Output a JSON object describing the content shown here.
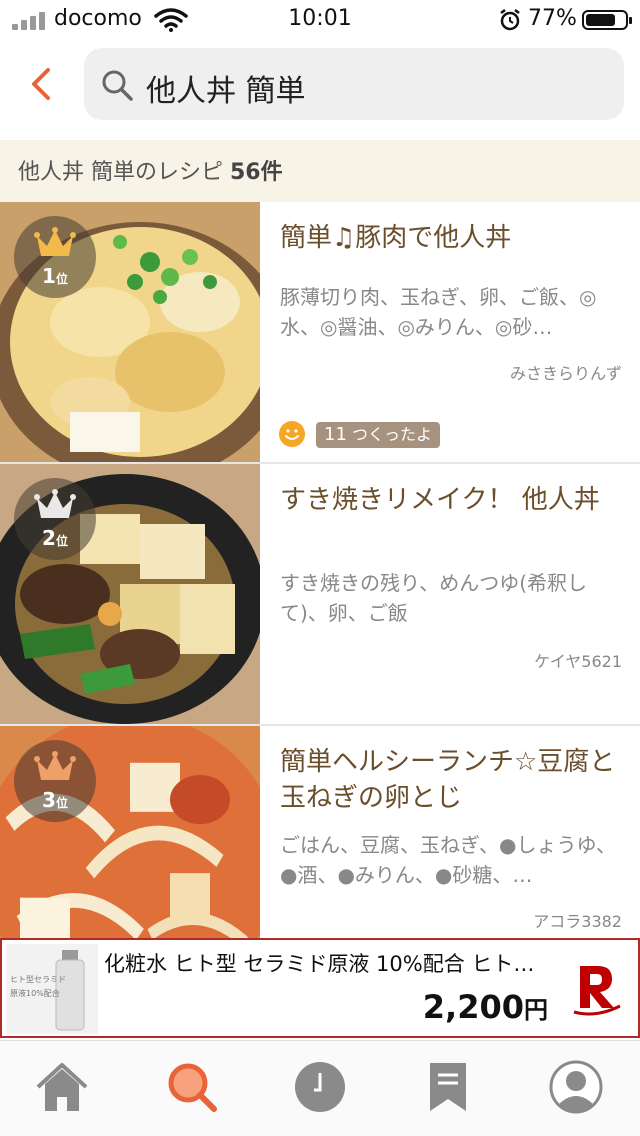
{
  "status_bar": {
    "carrier": "docomo",
    "time": "10:01",
    "battery": "77%",
    "battery_level": 0.77
  },
  "search": {
    "query": "他人丼 簡単"
  },
  "results": {
    "label": "他人丼 簡単のレシピ ",
    "count": "56件"
  },
  "recipes": [
    {
      "rank_number": "1",
      "rank_suffix": "位",
      "title": "簡単♫豚肉で他人丼",
      "ingredients": "豚薄切り肉、玉ねぎ、卵、ご飯、◎水、◎醤油、◎みりん、◎砂…",
      "author": "みさきらりんず",
      "tsukurepo_count": "11",
      "tsukurepo_label": "つくったよ"
    },
    {
      "rank_number": "2",
      "rank_suffix": "位",
      "title": "すき焼きリメイク！ 他人丼",
      "ingredients": "すき焼きの残り、めんつゆ(希釈して)、卵、ご飯",
      "author": "ケイヤ5621"
    },
    {
      "rank_number": "3",
      "rank_suffix": "位",
      "title": "簡単ヘルシーランチ☆豆腐と玉ねぎの卵とじ",
      "ingredients": "ごはん、豆腐、玉ねぎ、●しょうゆ、●酒、●みりん、●砂糖、…",
      "author": "アコラ3382"
    }
  ],
  "ad": {
    "title": "化粧水 ヒト型 セラミド原液 10%配合 ヒト…",
    "price": "2,200",
    "price_unit": "円",
    "thumb_text_1": "ヒト型セラミド",
    "thumb_text_2": "原液10%配合"
  },
  "tabs": [
    "home",
    "search",
    "history",
    "bookmarks",
    "profile"
  ],
  "colors": {
    "accent": "#e8633a",
    "title_brown": "#6b4e2b",
    "banner_bg": "#f7f3e6",
    "tab_gray": "#8a8a8a",
    "rank_gold": "#f2b94b",
    "rank_silver": "#e8e8e8",
    "rank_bronze": "#eea068",
    "ad_border": "#b02a2a"
  }
}
